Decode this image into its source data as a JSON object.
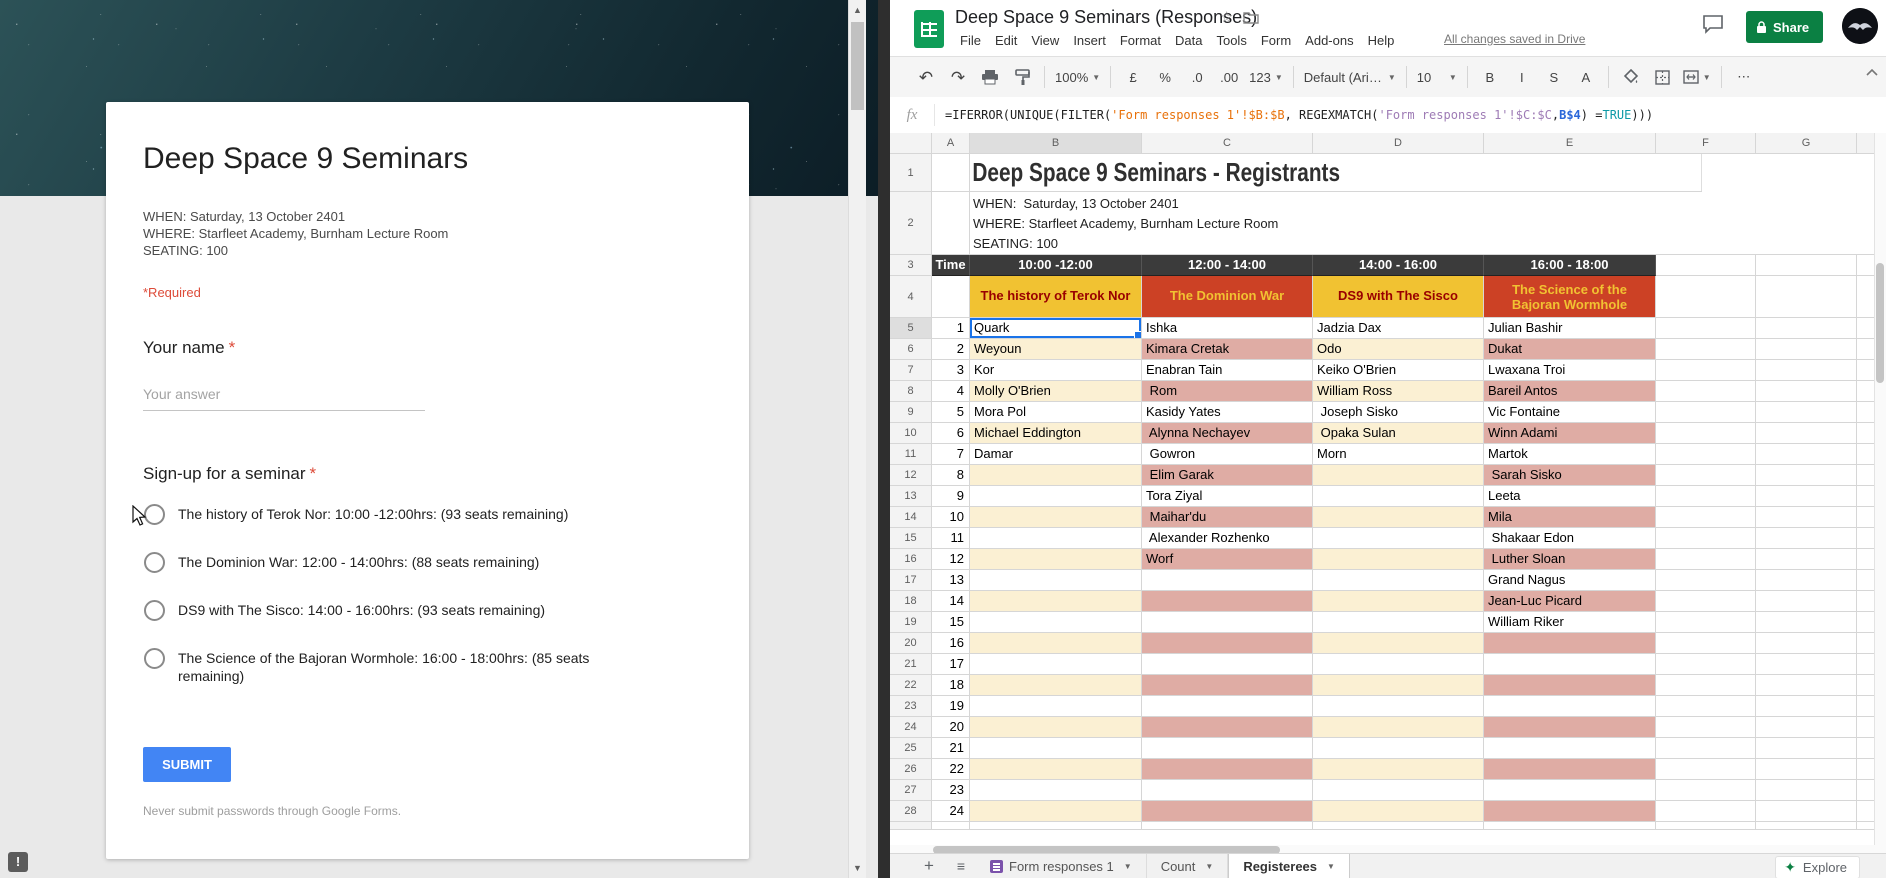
{
  "form": {
    "title": "Deep Space 9 Seminars",
    "description_lines": [
      "WHEN:  Saturday, 13 October 2401",
      "WHERE: Starfleet Academy, Burnham Lecture Room",
      "SEATING: 100"
    ],
    "required_note": "*Required",
    "name_question": {
      "label": "Your name",
      "required_mark": "*",
      "placeholder": "Your answer"
    },
    "seminar_question": {
      "label": "Sign-up for a seminar",
      "required_mark": "*",
      "options": [
        "The history of Terok Nor: 10:00 -12:00hrs: (93 seats remaining)",
        "The Dominion War: 12:00 - 14:00hrs: (88 seats remaining)",
        "DS9 with The Sisco: 14:00 - 16:00hrs: (93 seats remaining)",
        "The Science of the Bajoran Wormhole: 16:00 - 18:00hrs: (85 seats remaining)"
      ]
    },
    "submit_label": "SUBMIT",
    "footer_note": "Never submit passwords through Google Forms."
  },
  "sheet": {
    "header": {
      "doc_title": "Deep Space 9 Seminars (Responses)",
      "star_icon": "☆",
      "save_status": "All changes saved in Drive",
      "share_label": "Share"
    },
    "menu_items": [
      "File",
      "Edit",
      "View",
      "Insert",
      "Format",
      "Data",
      "Tools",
      "Form",
      "Add-ons",
      "Help"
    ],
    "toolbar": {
      "undo": "↶",
      "redo": "↷",
      "zoom_level": "100%",
      "currency": "£",
      "percent": "%",
      "decrease_decimal": ".0",
      "increase_decimal": ".00",
      "more_formats": "123",
      "font_family": "Default (Ari…",
      "font_size": "10",
      "bold": "B",
      "italic": "I",
      "strikethrough": "S",
      "text_color": "A",
      "more": "⋯"
    },
    "formula_bar": {
      "fx_label": "fx",
      "segments": [
        {
          "text": "=IFERROR(UNIQUE(FILTER(",
          "color": "#222222"
        },
        {
          "text": "'Form responses 1'!$B:$B",
          "color": "#e8710a"
        },
        {
          "text": ", REGEXMATCH(",
          "color": "#222222"
        },
        {
          "text": "'Form responses 1'!$C:$C",
          "color": "#9e7bb5"
        },
        {
          "text": ",",
          "color": "#222222"
        },
        {
          "text": "B$4",
          "color": "#2a66d9",
          "bold": true
        },
        {
          "text": ") =",
          "color": "#222222"
        },
        {
          "text": "TRUE",
          "color": "#0e9aa7"
        },
        {
          "text": ")))",
          "color": "#222222"
        }
      ]
    },
    "column_headers": [
      "A",
      "B",
      "C",
      "D",
      "E",
      "F",
      "G"
    ],
    "grid": {
      "title_row": "Deep Space 9 Seminars - Registrants",
      "info_lines": [
        "WHEN:  Saturday, 13 October 2401",
        "WHERE: Starfleet Academy, Burnham Lecture Room",
        "SEATING: 100"
      ],
      "time_row": {
        "a": "Time",
        "cols": [
          "10:00 -12:00",
          "12:00 - 14:00",
          "14:00 - 16:00",
          "16:00 - 18:00"
        ]
      },
      "seminar_row": [
        "The history of Terok Nor",
        "The Dominion War",
        "DS9 with The Sisco",
        "The Science of the\nBajoran Wormhole"
      ],
      "registrants": [
        {
          "n": 1,
          "b": "Quark",
          "c": "Ishka",
          "d": "Jadzia Dax",
          "e": "Julian Bashir"
        },
        {
          "n": 2,
          "b": "Weyoun",
          "c": "Kimara Cretak",
          "d": "Odo",
          "e": "Dukat"
        },
        {
          "n": 3,
          "b": "Kor",
          "c": "Enabran Tain",
          "d": "Keiko O'Brien",
          "e": "Lwaxana Troi"
        },
        {
          "n": 4,
          "b": "Molly O'Brien",
          "c": " Rom",
          "d": "William Ross",
          "e": "Bareil Antos"
        },
        {
          "n": 5,
          "b": "Mora Pol",
          "c": "Kasidy Yates",
          "d": " Joseph Sisko",
          "e": "Vic Fontaine"
        },
        {
          "n": 6,
          "b": "Michael Eddington",
          "c": " Alynna Nechayev",
          "d": " Opaka Sulan",
          "e": "Winn Adami"
        },
        {
          "n": 7,
          "b": "Damar",
          "c": " Gowron",
          "d": "Morn",
          "e": "Martok"
        },
        {
          "n": 8,
          "b": "",
          "c": " Elim Garak",
          "d": "",
          "e": " Sarah Sisko"
        },
        {
          "n": 9,
          "b": "",
          "c": "Tora Ziyal",
          "d": "",
          "e": "Leeta"
        },
        {
          "n": 10,
          "b": "",
          "c": " Maihar'du",
          "d": "",
          "e": "Mila"
        },
        {
          "n": 11,
          "b": "",
          "c": " Alexander Rozhenko",
          "d": "",
          "e": " Shakaar Edon"
        },
        {
          "n": 12,
          "b": "",
          "c": "Worf",
          "d": "",
          "e": " Luther Sloan"
        },
        {
          "n": 13,
          "b": "",
          "c": "",
          "d": "",
          "e": "Grand Nagus"
        },
        {
          "n": 14,
          "b": "",
          "c": "",
          "d": "",
          "e": "Jean-Luc Picard"
        },
        {
          "n": 15,
          "b": "",
          "c": "",
          "d": "",
          "e": "William Riker"
        },
        {
          "n": 16,
          "b": "",
          "c": "",
          "d": "",
          "e": ""
        },
        {
          "n": 17,
          "b": "",
          "c": "",
          "d": "",
          "e": ""
        },
        {
          "n": 18,
          "b": "",
          "c": "",
          "d": "",
          "e": ""
        },
        {
          "n": 19,
          "b": "",
          "c": "",
          "d": "",
          "e": ""
        },
        {
          "n": 20,
          "b": "",
          "c": "",
          "d": "",
          "e": ""
        },
        {
          "n": 21,
          "b": "",
          "c": "",
          "d": "",
          "e": ""
        },
        {
          "n": 22,
          "b": "",
          "c": "",
          "d": "",
          "e": ""
        },
        {
          "n": 23,
          "b": "",
          "c": "",
          "d": "",
          "e": ""
        },
        {
          "n": 24,
          "b": "",
          "c": "",
          "d": "",
          "e": ""
        }
      ],
      "selected_cell": "B5"
    },
    "bottom_bar": {
      "add_sheet": "+",
      "all_sheets": "≡",
      "tabs": [
        {
          "label": "Form responses 1",
          "has_form_icon": true,
          "active": false
        },
        {
          "label": "Count",
          "has_form_icon": false,
          "active": false
        },
        {
          "label": "Registerees",
          "has_form_icon": false,
          "active": true
        }
      ],
      "explore_label": "Explore"
    },
    "colors": {
      "accent_blue": "#4285f4",
      "share_green": "#0b8043",
      "sheets_green": "#0f9d58",
      "header_dark": "#3b3b3b",
      "seminar_yellow": "#f1c232",
      "seminar_red": "#cc4125",
      "row_cream": "#fbf0d3",
      "row_pink": "#dfaca4",
      "selection_blue": "#1a73e8",
      "forms_purple": "#7b52ab"
    }
  }
}
